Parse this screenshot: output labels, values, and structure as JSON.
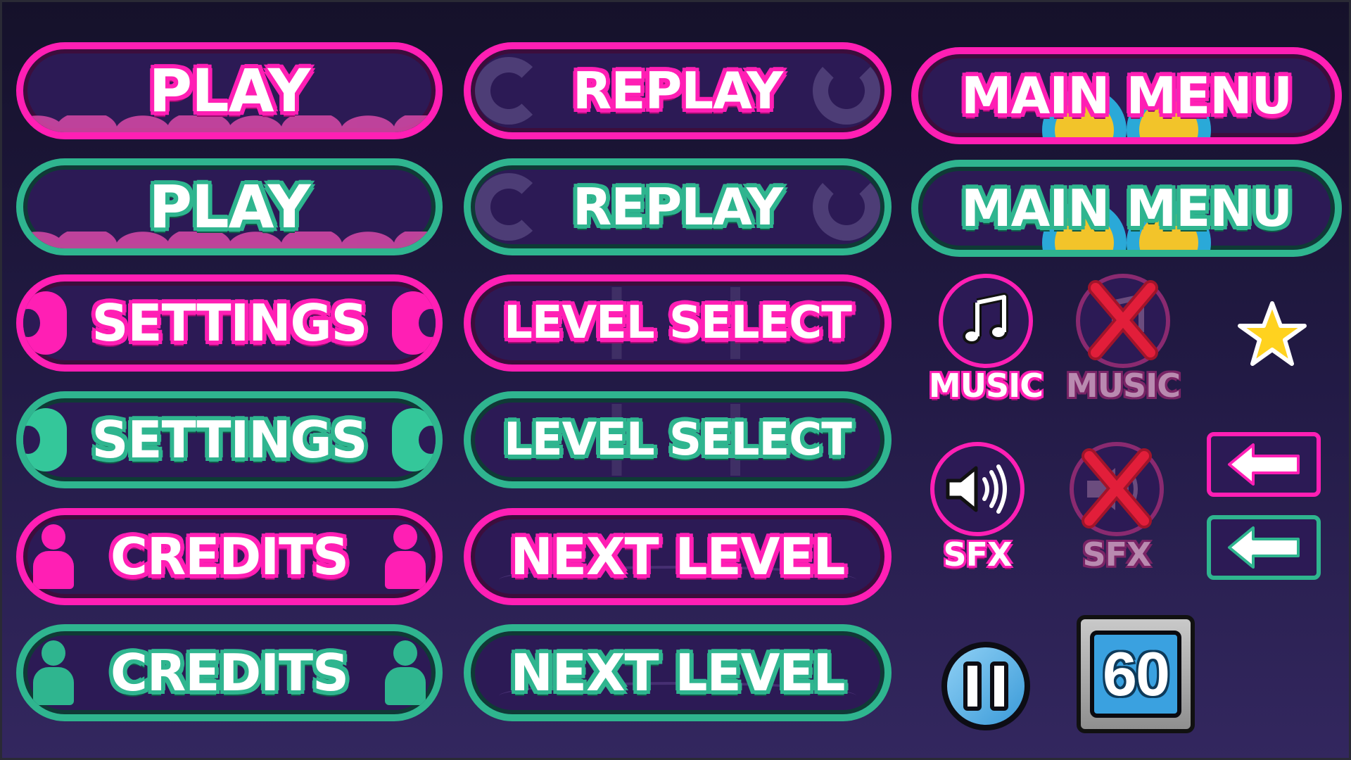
{
  "buttons": {
    "play": "PLAY",
    "replay": "REPLAY",
    "main_menu": "MAIN MENU",
    "settings": "SETTINGS",
    "level_select": "LEVEL SELECT",
    "credits": "CREDITS",
    "next_level": "NEXT LEVEL"
  },
  "toggles": {
    "music_on": "MUSIC",
    "music_off": "MUSIC",
    "sfx_on": "SFX",
    "sfx_off": "SFX"
  },
  "timer": {
    "value": "60"
  },
  "icons": {
    "music": "music-note-icon",
    "sfx": "speaker-icon",
    "star": "star-icon",
    "back": "left-arrow-icon",
    "pause": "pause-icon"
  },
  "colors": {
    "pink": "#ff1fb4",
    "teal": "#2fb58f",
    "button_fill": "#2c1a55",
    "timer_blue": "#3aa1e0",
    "star_yellow": "#ffd21f"
  }
}
